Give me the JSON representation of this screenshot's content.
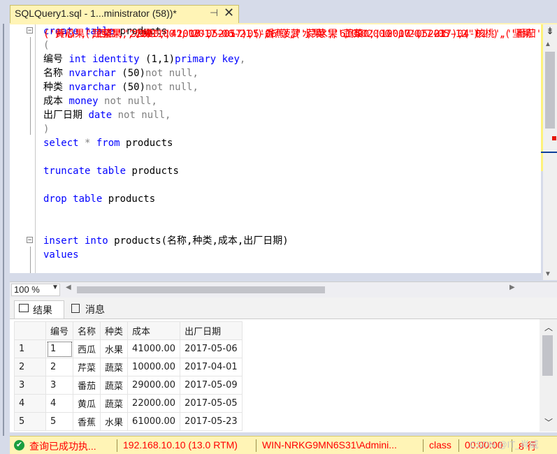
{
  "tab": {
    "title": "SQLQuery1.sql - 1...ministrator (58))*",
    "pin": "⊣",
    "close": "✕"
  },
  "editor": {
    "lines": [
      [
        {
          "t": "create table ",
          "c": "kw"
        },
        {
          "t": "products",
          "c": "tx"
        }
      ],
      [
        {
          "t": "(",
          "c": "gr"
        }
      ],
      [
        {
          "t": "编号 ",
          "c": "tx"
        },
        {
          "t": "int identity ",
          "c": "kw"
        },
        {
          "t": "(1,1)",
          "c": "tx"
        },
        {
          "t": "primary key",
          "c": "kw"
        },
        {
          "t": ",",
          "c": "gr"
        }
      ],
      [
        {
          "t": "名称 ",
          "c": "tx"
        },
        {
          "t": "nvarchar ",
          "c": "kw"
        },
        {
          "t": "(50)",
          "c": "tx"
        },
        {
          "t": "not null,",
          "c": "gr"
        }
      ],
      [
        {
          "t": "种类 ",
          "c": "tx"
        },
        {
          "t": "nvarchar ",
          "c": "kw"
        },
        {
          "t": "(50)",
          "c": "tx"
        },
        {
          "t": "not null,",
          "c": "gr"
        }
      ],
      [
        {
          "t": "成本 ",
          "c": "tx"
        },
        {
          "t": "money ",
          "c": "kw"
        },
        {
          "t": "not null,",
          "c": "gr"
        }
      ],
      [
        {
          "t": "出厂日期 ",
          "c": "tx"
        },
        {
          "t": "date ",
          "c": "kw"
        },
        {
          "t": "not null,",
          "c": "gr"
        }
      ],
      [
        {
          "t": ")",
          "c": "gr"
        }
      ],
      [
        {
          "t": "select ",
          "c": "kw"
        },
        {
          "t": "* ",
          "c": "gr"
        },
        {
          "t": "from ",
          "c": "kw"
        },
        {
          "t": "products",
          "c": "tx"
        }
      ],
      [],
      [
        {
          "t": "truncate table ",
          "c": "kw"
        },
        {
          "t": "products",
          "c": "tx"
        }
      ],
      [],
      [
        {
          "t": "drop table ",
          "c": "kw"
        },
        {
          "t": "products",
          "c": "tx"
        }
      ],
      [],
      [],
      [
        {
          "t": "insert into ",
          "c": "kw"
        },
        {
          "t": "products(名称,种类,成本,出厂日期)",
          "c": "tx"
        }
      ],
      [
        {
          "t": "values ",
          "c": "kw"
        },
        {
          "t": "('西瓜','水果','41000','2017-05-06'),('芹菜','蔬菜','10000','2017-04-01'),('番茄'",
          "c": "st"
        }
      ],
      [
        {
          "t": "('黄瓜','蔬菜','22000','2017-05-05'),('香蕉','水果','61000','2017-05-23'),('核桃','坚果'",
          "c": "st"
        }
      ],
      [
        {
          "t": "('开心果','坚果','381100','2017-06-21'),('菠萝','水果','502000','2017-05-12')",
          "c": "st"
        }
      ]
    ]
  },
  "zoom": "100 %",
  "results": {
    "tab_results": "结果",
    "tab_messages": "消息",
    "columns": [
      "编号",
      "名称",
      "种类",
      "成本",
      "出厂日期"
    ],
    "rows": [
      [
        "1",
        "1",
        "西瓜",
        "水果",
        "41000.00",
        "2017-05-06"
      ],
      [
        "2",
        "2",
        "芹菜",
        "蔬菜",
        "10000.00",
        "2017-04-01"
      ],
      [
        "3",
        "3",
        "番茄",
        "蔬菜",
        "29000.00",
        "2017-05-09"
      ],
      [
        "4",
        "4",
        "黄瓜",
        "蔬菜",
        "22000.00",
        "2017-05-05"
      ],
      [
        "5",
        "5",
        "香蕉",
        "水果",
        "61000.00",
        "2017-05-23"
      ]
    ]
  },
  "status": {
    "message": "查询已成功执...",
    "server": "192.168.10.10 (13.0 RTM)",
    "user": "WIN-NRKG9MN6S31\\Admini...",
    "database": "class",
    "time": "00:00:00",
    "rows": "8 行"
  },
  "watermark": "CSDN @IT_肖威",
  "colors": {
    "status_bg": "#fff4b6",
    "success": "#1a9e3f",
    "keyword": "#0000ff",
    "string": "#ff0000"
  }
}
